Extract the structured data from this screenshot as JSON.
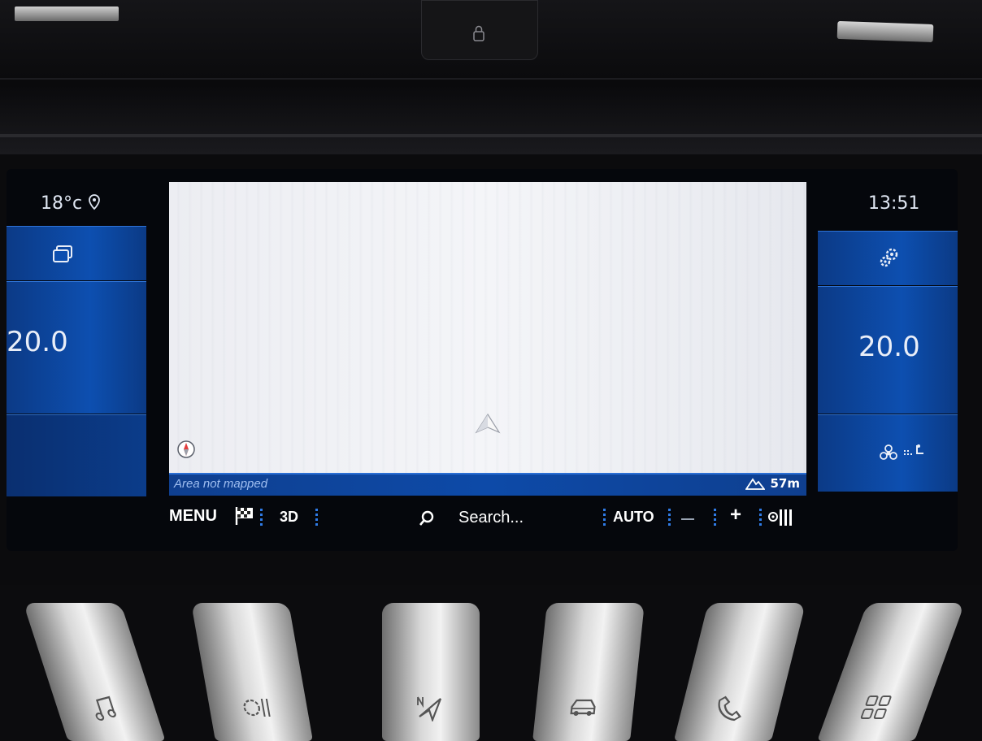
{
  "status": {
    "outside_temp": "18°c",
    "clock": "13:51"
  },
  "climate": {
    "left_temp": "20.0",
    "right_temp": "20.0"
  },
  "map": {
    "status_text": "Area not mapped",
    "altitude": "57m"
  },
  "toolbar": {
    "menu_label": "MENU",
    "view_label": "3D",
    "search_label": "Search...",
    "auto_label": "AUTO",
    "plus_label": "+"
  },
  "icons": {
    "location": "location-pin-icon",
    "windows": "windows-icon",
    "settings": "gears-icon",
    "fan": "fan-icon",
    "seat_air": "seat-airflow-icon",
    "flag": "checkered-flag-icon",
    "search": "magnifier-icon",
    "zoom_out": "minus-icon",
    "guidance": "lane-guidance-icon",
    "compass": "compass-icon",
    "mountain": "mountain-icon",
    "nav_arrow": "navigation-arrow-icon",
    "keys": [
      "music-icon",
      "climate-icon",
      "navigation-icon",
      "vehicle-icon",
      "phone-icon",
      "apps-icon"
    ]
  },
  "colors": {
    "accent": "#0d4fb0",
    "accent_light": "#2f7be6"
  }
}
